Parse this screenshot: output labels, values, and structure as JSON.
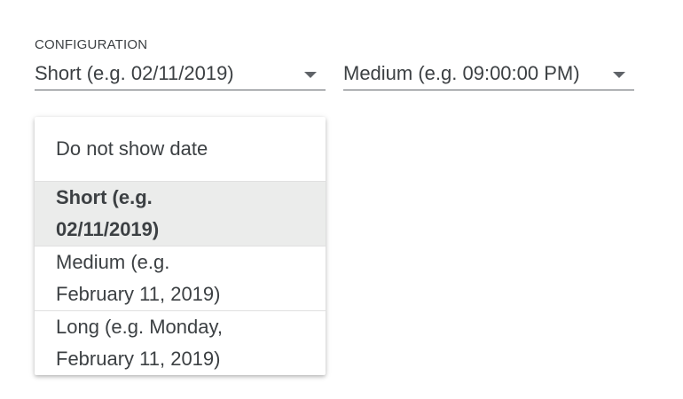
{
  "config": {
    "label": "CONFIGURATION",
    "date_select": {
      "value": "Short (e.g. 02/11/2019)"
    },
    "time_select": {
      "value": "Medium (e.g. 09:00:00 PM)"
    }
  },
  "date_menu": {
    "items": [
      {
        "label": "Do not show date",
        "selected": false
      },
      {
        "label": "Short (e.g. 02/11/2019)",
        "selected": true
      },
      {
        "label": "Medium (e.g. February 11, 2019)",
        "selected": false
      },
      {
        "label": "Long (e.g. Monday, February 11, 2019)",
        "selected": false
      }
    ]
  },
  "colors": {
    "text": "#3c4043",
    "selected_bg": "#ebeceb",
    "divider": "#e0e0e0"
  },
  "icons": {
    "dropdown": "triangle-down-icon"
  }
}
